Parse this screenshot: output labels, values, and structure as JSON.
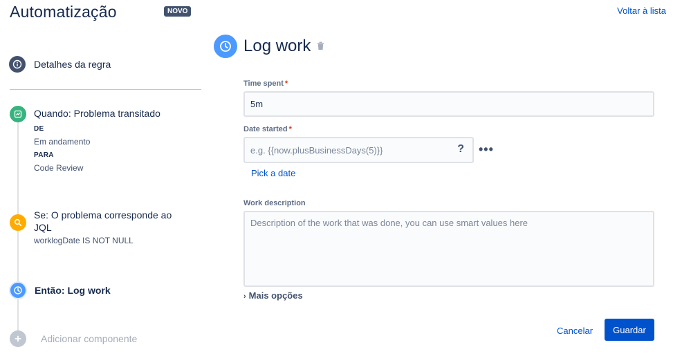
{
  "header": {
    "title": "Automatização",
    "badge": "NOVO",
    "back_link": "Voltar à lista"
  },
  "rule": {
    "details": "Detalhes da regra",
    "trigger": {
      "title": "Quando: Problema transitado",
      "from_label": "DE",
      "from_value": "Em andamento",
      "to_label": "PARA",
      "to_value": "Code Review"
    },
    "condition": {
      "title_line1": "Se: O problema corresponde ao",
      "title_line2": "JQL",
      "query": "worklogDate IS NOT NULL"
    },
    "action": {
      "title": "Então: Log work"
    },
    "add_component": "Adicionar componente"
  },
  "component": {
    "title": "Log work",
    "time_spent": {
      "label": "Time spent",
      "required_mark": "*",
      "value": "5m"
    },
    "date_started": {
      "label": "Date started",
      "required_mark": "*",
      "placeholder": "e.g. {{now.plusBusinessDays(5)}}",
      "help": "?",
      "more": "•••",
      "pick_link": "Pick a date"
    },
    "work_description": {
      "label": "Work description",
      "placeholder": "Description of the work that was done, you can use smart values here"
    },
    "more_options": "Mais opções",
    "cancel": "Cancelar",
    "save": "Guardar"
  },
  "colors": {
    "accent": "#0052cc",
    "trigger_green": "#36b37e",
    "condition_orange": "#ffab00",
    "action_blue": "#4c9aff",
    "info_gray": "#42526e"
  }
}
